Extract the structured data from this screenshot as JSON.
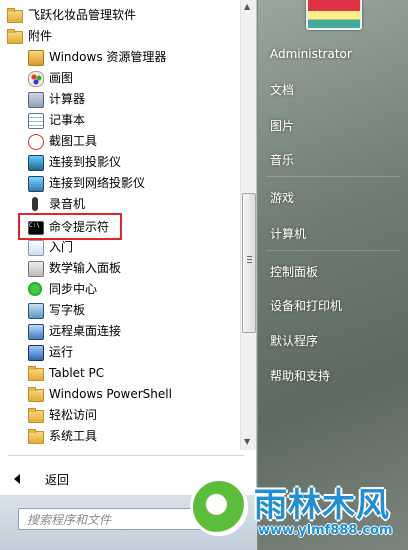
{
  "programs": [
    {
      "label": "飞跃化妆品管理软件",
      "icon": "folder-icon"
    },
    {
      "label": "附件",
      "icon": "folder-icon"
    },
    {
      "label": "Windows 资源管理器",
      "icon": "explorer-icon"
    },
    {
      "label": "画图",
      "icon": "paint-icon"
    },
    {
      "label": "计算器",
      "icon": "calculator-icon"
    },
    {
      "label": "记事本",
      "icon": "notepad-icon"
    },
    {
      "label": "截图工具",
      "icon": "snipping-tool-icon"
    },
    {
      "label": "连接到投影仪",
      "icon": "projector-icon"
    },
    {
      "label": "连接到网络投影仪",
      "icon": "network-projector-icon"
    },
    {
      "label": "录音机",
      "icon": "microphone-icon"
    },
    {
      "label": "命令提示符",
      "icon": "command-prompt-icon"
    },
    {
      "label": "入门",
      "icon": "getting-started-icon"
    },
    {
      "label": "数学输入面板",
      "icon": "math-input-icon"
    },
    {
      "label": "同步中心",
      "icon": "sync-center-icon"
    },
    {
      "label": "写字板",
      "icon": "wordpad-icon"
    },
    {
      "label": "远程桌面连接",
      "icon": "remote-desktop-icon"
    },
    {
      "label": "运行",
      "icon": "run-icon"
    },
    {
      "label": "Tablet PC",
      "icon": "folder-icon"
    },
    {
      "label": "Windows PowerShell",
      "icon": "folder-icon"
    },
    {
      "label": "轻松访问",
      "icon": "folder-icon"
    },
    {
      "label": "系统工具",
      "icon": "folder-icon"
    }
  ],
  "back_label": "返回",
  "search_placeholder": "搜索程序和文件",
  "right_items": [
    "Administrator",
    "文档",
    "图片",
    "音乐",
    "游戏",
    "计算机",
    "控制面板",
    "设备和打印机",
    "默认程序",
    "帮助和支持"
  ],
  "watermark": {
    "title": "雨林木风",
    "url": "www.ylmf888.com"
  },
  "colors": {
    "highlight": "#e0252c",
    "watermark": "#1f8fd6"
  }
}
